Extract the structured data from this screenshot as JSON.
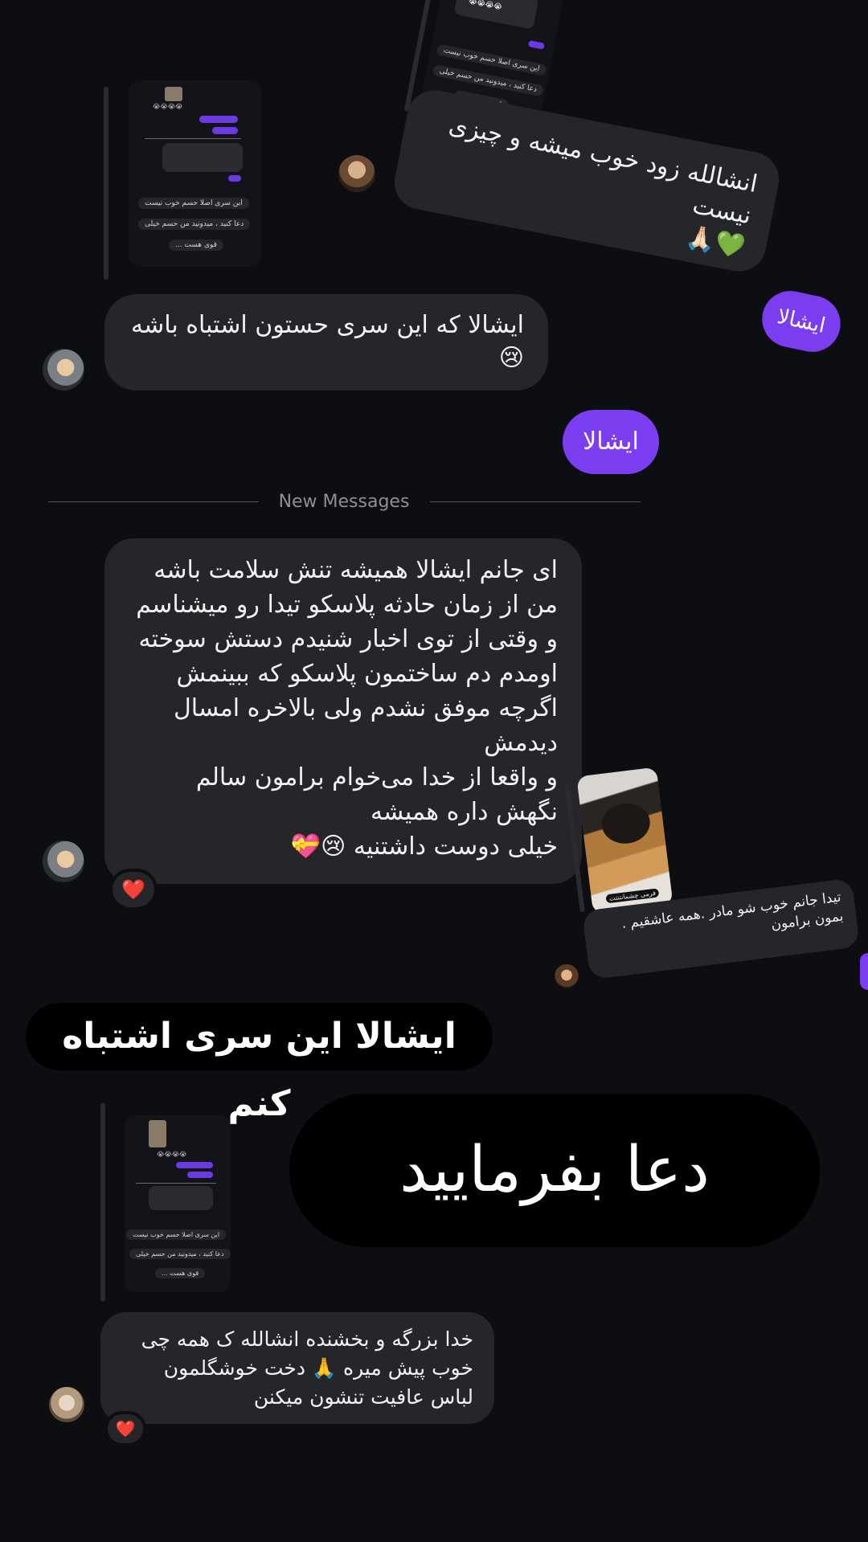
{
  "messages": {
    "insha_zood": "انشالله زود خوب میشه و چیزی نیست",
    "insha_zood_emoji": "💚🙏🏻",
    "ishala_small": "ایشالا",
    "ishala_wrong": "ایشالا که این سری حستون اشتباه باشه",
    "ishala_wrong_emoji": "😢",
    "ishala_big": "ایشالا",
    "new_messages": "New Messages",
    "long_lines": [
      "ای جانم ایشالا همیشه تنش سلامت باشه",
      "من از زمان حادثه پلاسکو تیدا رو میشناسم",
      "و وقتی از توی اخبار شنیدم دستش سوخته",
      "اومدم دم ساختمون پلاسکو که ببینمش",
      "اگرچه موفق نشدم ولی بالاخره امسال",
      "دیدمش",
      "و واقعا از خدا می‌خوام برامون سالم",
      "نگهش داره همیشه",
      "خیلی دوست داشتنیه"
    ],
    "long_emoji": "😢💝",
    "reaction_heart": "❤️",
    "tida_caption_line1": "تیدا جانم خوب شو مادر .همه عاشقیم .",
    "tida_caption_line2": "بمون برامون",
    "photo_caption": "فرمی چشمانتتتت",
    "ishala_sticker": "ایشالا این سری اشتباه کنم",
    "doa_sticker": "دعا بفرمایید",
    "final_lines": [
      "خدا بزرگه و بخشنده  انشالله ک همه چی",
      "خوب پیش میره 🙏 دخت  خوشگلمون",
      "لباس عافیت تنشون میکنن"
    ]
  },
  "mini_story": {
    "line1": "این سری اصلا حسم خوب نیست",
    "line2": "دعا کنید ، میدونید من حسم خیلی",
    "line3": "قوی هست ...",
    "emoji_row": "😭😭😭😭"
  },
  "colors": {
    "background": "#0d0e12",
    "bubble": "#25262a",
    "accent": "#7b3df0",
    "heart": "#e0203a"
  },
  "icons": {
    "reaction": "red-heart-icon"
  }
}
